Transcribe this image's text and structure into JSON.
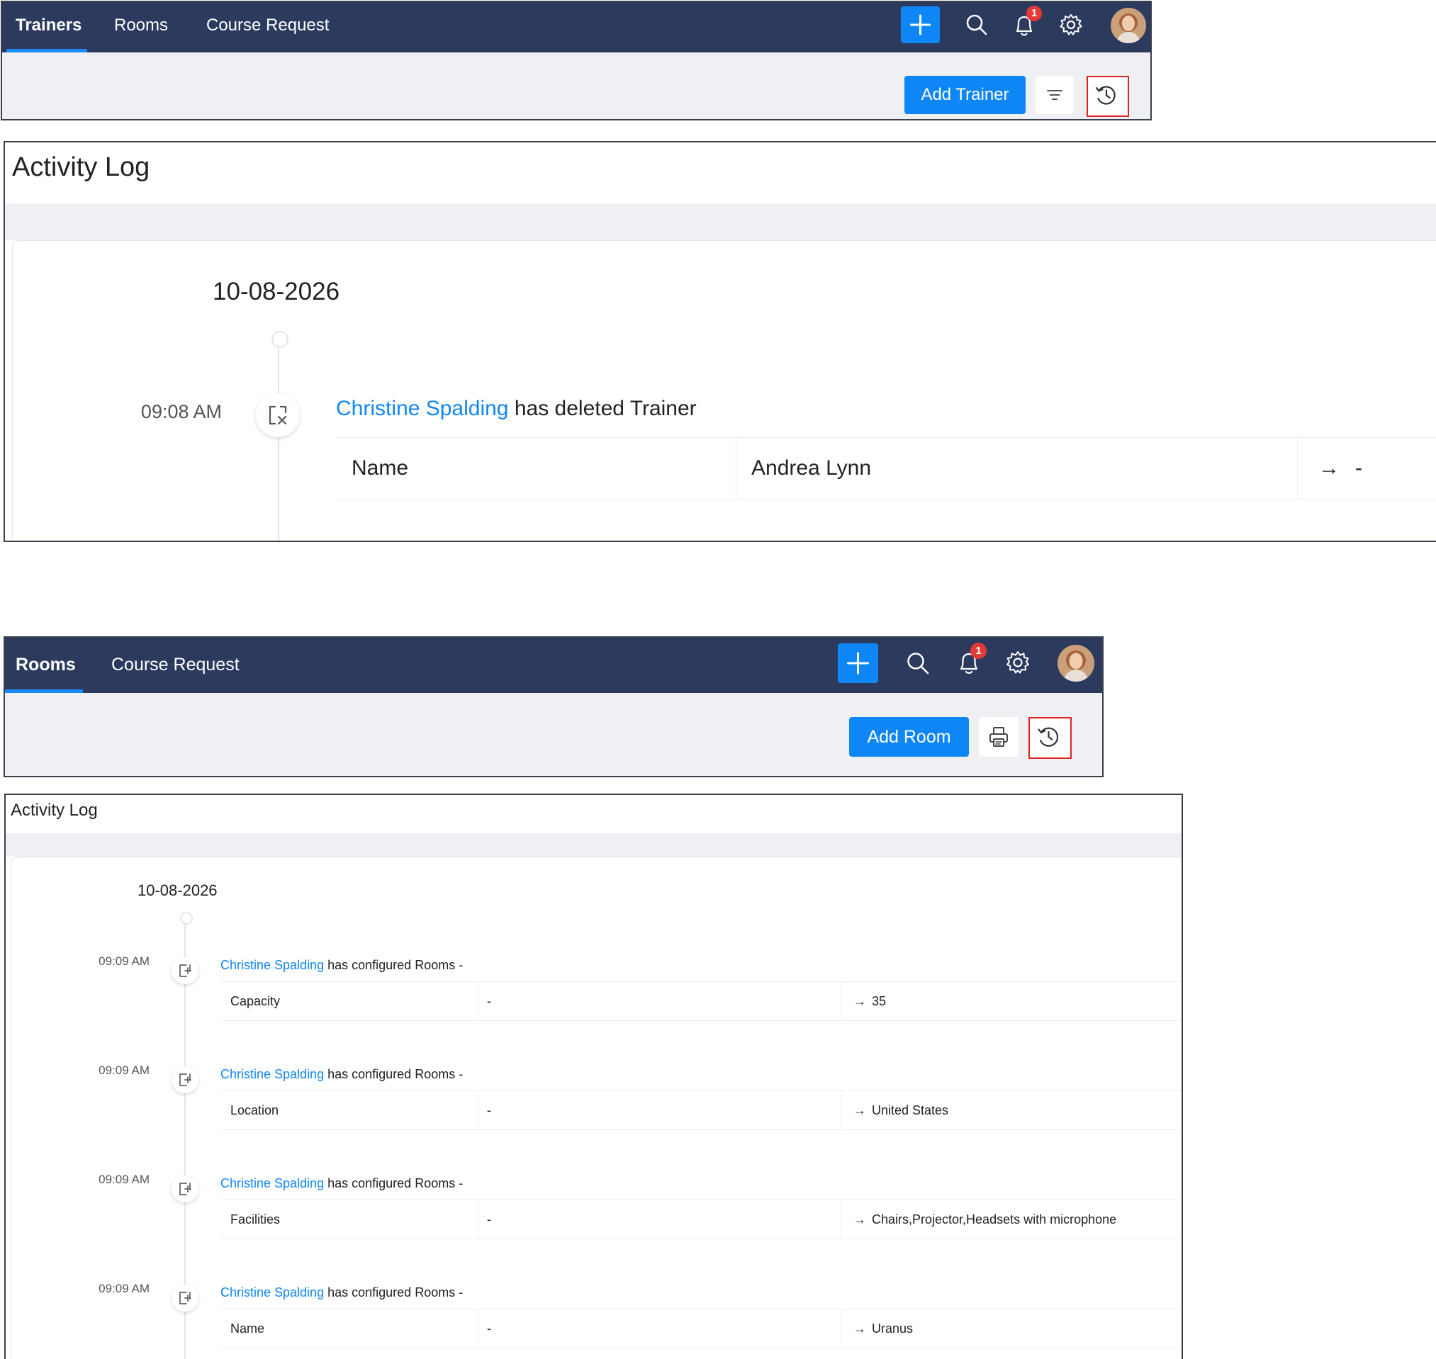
{
  "top_header": {
    "tabs": [
      {
        "label": "Trainers",
        "active": true
      },
      {
        "label": "Rooms",
        "active": false
      },
      {
        "label": "Course Request",
        "active": false
      }
    ],
    "notification_count": "1",
    "add_button_label": "Add Trainer"
  },
  "top_log": {
    "title": "Activity Log",
    "date": "10-08-2026",
    "entries": [
      {
        "time": "09:08 AM",
        "icon": "delete-record-icon",
        "user": "Christine Spalding",
        "action": "has deleted Trainer",
        "field": "Name",
        "old_value": "Andrea Lynn",
        "arrow": "→",
        "new_value": "-"
      }
    ]
  },
  "bottom_header": {
    "tabs": [
      {
        "label": "Rooms",
        "active": true
      },
      {
        "label": "Course Request",
        "active": false
      }
    ],
    "notification_count": "1",
    "add_button_label": "Add Room"
  },
  "bottom_log": {
    "title": "Activity Log",
    "date": "10-08-2026",
    "entries": [
      {
        "time": "09:09 AM",
        "icon": "configure-add-icon",
        "user": "Christine Spalding",
        "action": "has configured Rooms -",
        "field": "Capacity",
        "old_value": "-",
        "arrow": "→",
        "new_value": "35"
      },
      {
        "time": "09:09 AM",
        "icon": "configure-add-icon",
        "user": "Christine Spalding",
        "action": "has configured Rooms -",
        "field": "Location",
        "old_value": "-",
        "arrow": "→",
        "new_value": "United States"
      },
      {
        "time": "09:09 AM",
        "icon": "configure-add-icon",
        "user": "Christine Spalding",
        "action": "has configured Rooms -",
        "field": "Facilities",
        "old_value": "-",
        "arrow": "→",
        "new_value": "Chairs,Projector,Headsets with microphone"
      },
      {
        "time": "09:09 AM",
        "icon": "configure-add-icon",
        "user": "Christine Spalding",
        "action": "has configured Rooms -",
        "field": "Name",
        "old_value": "-",
        "arrow": "→",
        "new_value": "Uranus"
      }
    ]
  },
  "colors": {
    "navbar": "#2c3a5e",
    "accent": "#0f86f5",
    "badge": "#e53935",
    "highlight": "#e02424",
    "subbar": "#eff0f3"
  }
}
